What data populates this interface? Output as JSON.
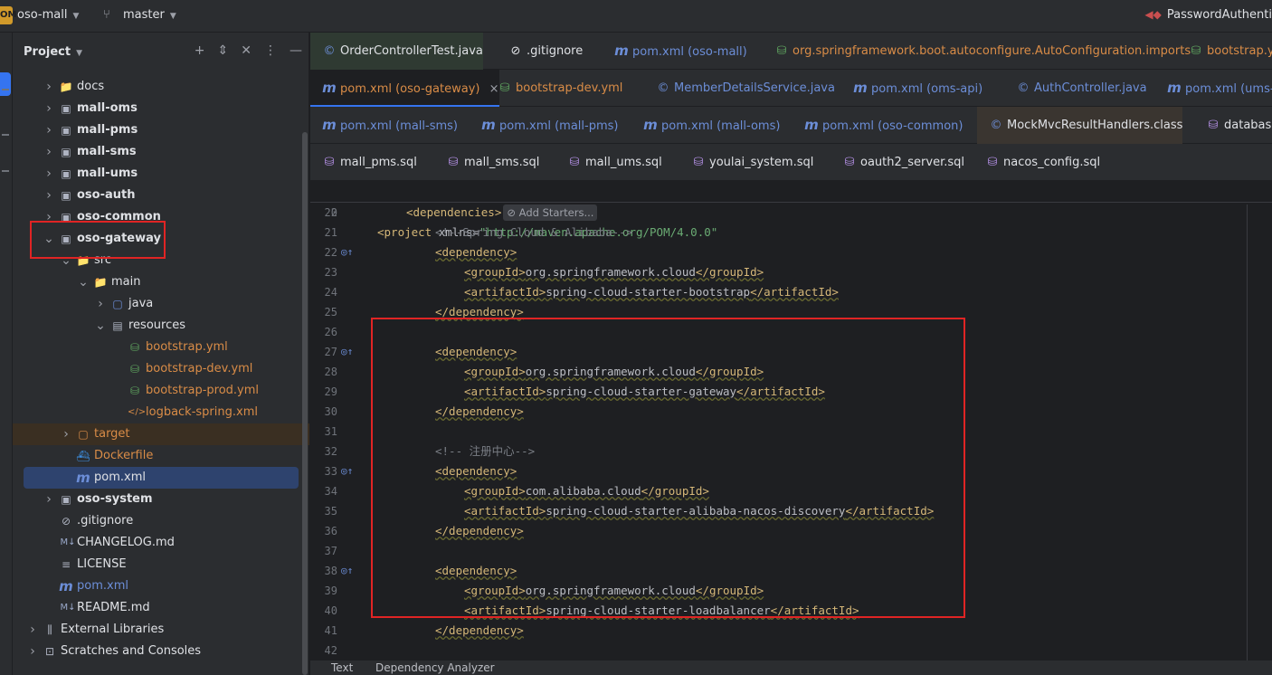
{
  "titlebar": {
    "project_badge": "OM",
    "project_name": "oso-mall",
    "branch_name": "master",
    "run_config": "PasswordAuthenti"
  },
  "project_panel": {
    "title": "Project",
    "tree": [
      {
        "label": "docs",
        "type": "folder",
        "expanded": false
      },
      {
        "label": "mall-oms",
        "type": "module",
        "expanded": false
      },
      {
        "label": "mall-pms",
        "type": "module",
        "expanded": false
      },
      {
        "label": "mall-sms",
        "type": "module",
        "expanded": false
      },
      {
        "label": "mall-ums",
        "type": "module",
        "expanded": false
      },
      {
        "label": "oso-auth",
        "type": "module",
        "expanded": false
      },
      {
        "label": "oso-common",
        "type": "module",
        "expanded": false
      },
      {
        "label": "oso-gateway",
        "type": "module",
        "expanded": true
      },
      {
        "label": "src",
        "type": "folder",
        "expanded": true
      },
      {
        "label": "main",
        "type": "folder",
        "expanded": true
      },
      {
        "label": "java",
        "type": "source-folder",
        "expanded": false
      },
      {
        "label": "resources",
        "type": "resource-folder",
        "expanded": true
      },
      {
        "label": "bootstrap.yml",
        "type": "yml"
      },
      {
        "label": "bootstrap-dev.yml",
        "type": "yml"
      },
      {
        "label": "bootstrap-prod.yml",
        "type": "yml"
      },
      {
        "label": "logback-spring.xml",
        "type": "xml"
      },
      {
        "label": "target",
        "type": "excluded-folder",
        "expanded": false
      },
      {
        "label": "Dockerfile",
        "type": "docker"
      },
      {
        "label": "pom.xml",
        "type": "maven",
        "selected": true
      },
      {
        "label": "oso-system",
        "type": "module",
        "expanded": false
      },
      {
        "label": ".gitignore",
        "type": "ignore"
      },
      {
        "label": "CHANGELOG.md",
        "type": "markdown"
      },
      {
        "label": "LICENSE",
        "type": "text"
      },
      {
        "label": "pom.xml",
        "type": "maven"
      },
      {
        "label": "README.md",
        "type": "markdown"
      },
      {
        "label": "External Libraries",
        "type": "libraries",
        "expanded": false
      },
      {
        "label": "Scratches and Consoles",
        "type": "scratches",
        "expanded": false
      }
    ]
  },
  "editor_tabs": {
    "row1": [
      "OrderControllerTest.java",
      ".gitignore",
      "pom.xml (oso-mall)",
      "org.springframework.boot.autoconfigure.AutoConfiguration.imports",
      "bootstrap.ym"
    ],
    "row2": [
      "pom.xml (oso-gateway)",
      "bootstrap-dev.yml",
      "MemberDetailsService.java",
      "pom.xml (oms-api)",
      "AuthController.java",
      "pom.xml (ums-a"
    ],
    "row3": [
      "pom.xml (mall-sms)",
      "pom.xml (mall-pms)",
      "pom.xml (mall-oms)",
      "pom.xml (oso-common)",
      "MockMvcResultHandlers.class",
      "database"
    ],
    "row4": [
      "mall_pms.sql",
      "mall_sms.sql",
      "mall_ums.sql",
      "youlai_system.sql",
      "oauth2_server.sql",
      "nacos_config.sql"
    ],
    "close_glyph": "×"
  },
  "code": {
    "sticky_line": {
      "num": "2",
      "open": "<project ",
      "attr": "xmlns=",
      "value": "\"http://maven.apache.org/POM/4.0.0\""
    },
    "add_starters": "Add Starters...",
    "lines": [
      {
        "num": "20",
        "text": "<dependencies>"
      },
      {
        "num": "21",
        "text": "<!--Spring Cloud & Alibaba-->"
      },
      {
        "num": "22",
        "text": "<dependency>"
      },
      {
        "num": "23",
        "text": "<groupId>org.springframework.cloud</groupId>"
      },
      {
        "num": "24",
        "text": "<artifactId>spring-cloud-starter-bootstrap</artifactId>"
      },
      {
        "num": "25",
        "text": "</dependency>"
      },
      {
        "num": "26",
        "text": ""
      },
      {
        "num": "27",
        "text": "<dependency>"
      },
      {
        "num": "28",
        "text": "<groupId>org.springframework.cloud</groupId>"
      },
      {
        "num": "29",
        "text": "<artifactId>spring-cloud-starter-gateway</artifactId>"
      },
      {
        "num": "30",
        "text": "</dependency>"
      },
      {
        "num": "31",
        "text": ""
      },
      {
        "num": "32",
        "text": "<!-- 注册中心-->"
      },
      {
        "num": "33",
        "text": "<dependency>"
      },
      {
        "num": "34",
        "text": "<groupId>com.alibaba.cloud</groupId>"
      },
      {
        "num": "35",
        "text": "<artifactId>spring-cloud-starter-alibaba-nacos-discovery</artifactId>"
      },
      {
        "num": "36",
        "text": "</dependency>"
      },
      {
        "num": "37",
        "text": ""
      },
      {
        "num": "38",
        "text": "<dependency>"
      },
      {
        "num": "39",
        "text": "<groupId>org.springframework.cloud</groupId>"
      },
      {
        "num": "40",
        "text": "<artifactId>spring-cloud-starter-loadbalancer</artifactId>"
      },
      {
        "num": "41",
        "text": "</dependency>"
      },
      {
        "num": "42",
        "text": ""
      }
    ]
  },
  "bottom_tabs": [
    "Text",
    "Dependency Analyzer"
  ],
  "colors": {
    "accent": "#3574f0",
    "annotation_box": "#e02424",
    "xml_tag": "#d5b778",
    "xml_string": "#6aab73"
  }
}
